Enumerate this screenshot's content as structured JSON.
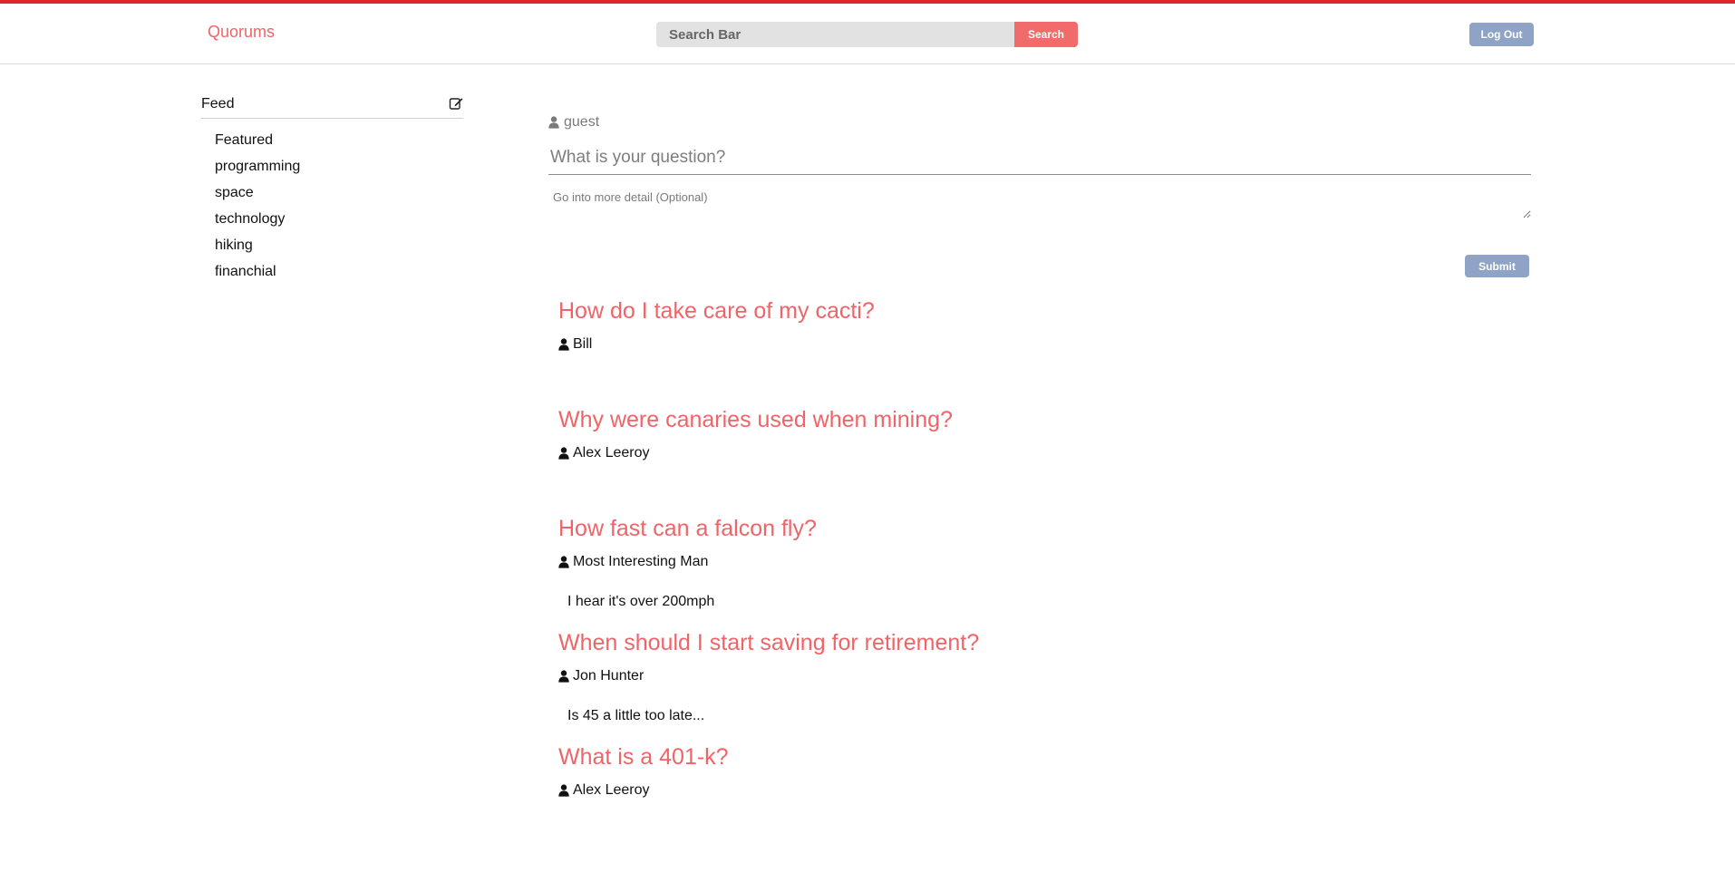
{
  "header": {
    "brand": "Quorums",
    "search_placeholder": "Search Bar",
    "search_button": "Search",
    "logout_button": "Log Out"
  },
  "sidebar": {
    "feed_label": "Feed",
    "topics": [
      "Featured",
      "programming",
      "space",
      "technology",
      "hiking",
      "financhial"
    ]
  },
  "ask": {
    "username": "guest",
    "question_placeholder": "What is your question?",
    "detail_placeholder": "Go into more detail (Optional)",
    "submit_button": "Submit"
  },
  "questions": [
    {
      "title": "How do I take care of my cacti?",
      "author": "Bill",
      "body": ""
    },
    {
      "title": "Why were canaries used when mining?",
      "author": "Alex Leeroy",
      "body": ""
    },
    {
      "title": "How fast can a falcon fly?",
      "author": "Most Interesting Man",
      "body": "I hear it's over 200mph"
    },
    {
      "title": "When should I start saving for retirement?",
      "author": "Jon Hunter",
      "body": "Is 45 a little too late..."
    },
    {
      "title": "What is a 401-k?",
      "author": "Alex Leeroy",
      "body": ""
    }
  ],
  "colors": {
    "accent": "#f06468",
    "top_stripe": "#e0262a",
    "button_blue": "#8fa3c6",
    "search_button": "#f26b6b"
  },
  "icons": {
    "user": "user-icon",
    "compose": "edit-icon"
  }
}
